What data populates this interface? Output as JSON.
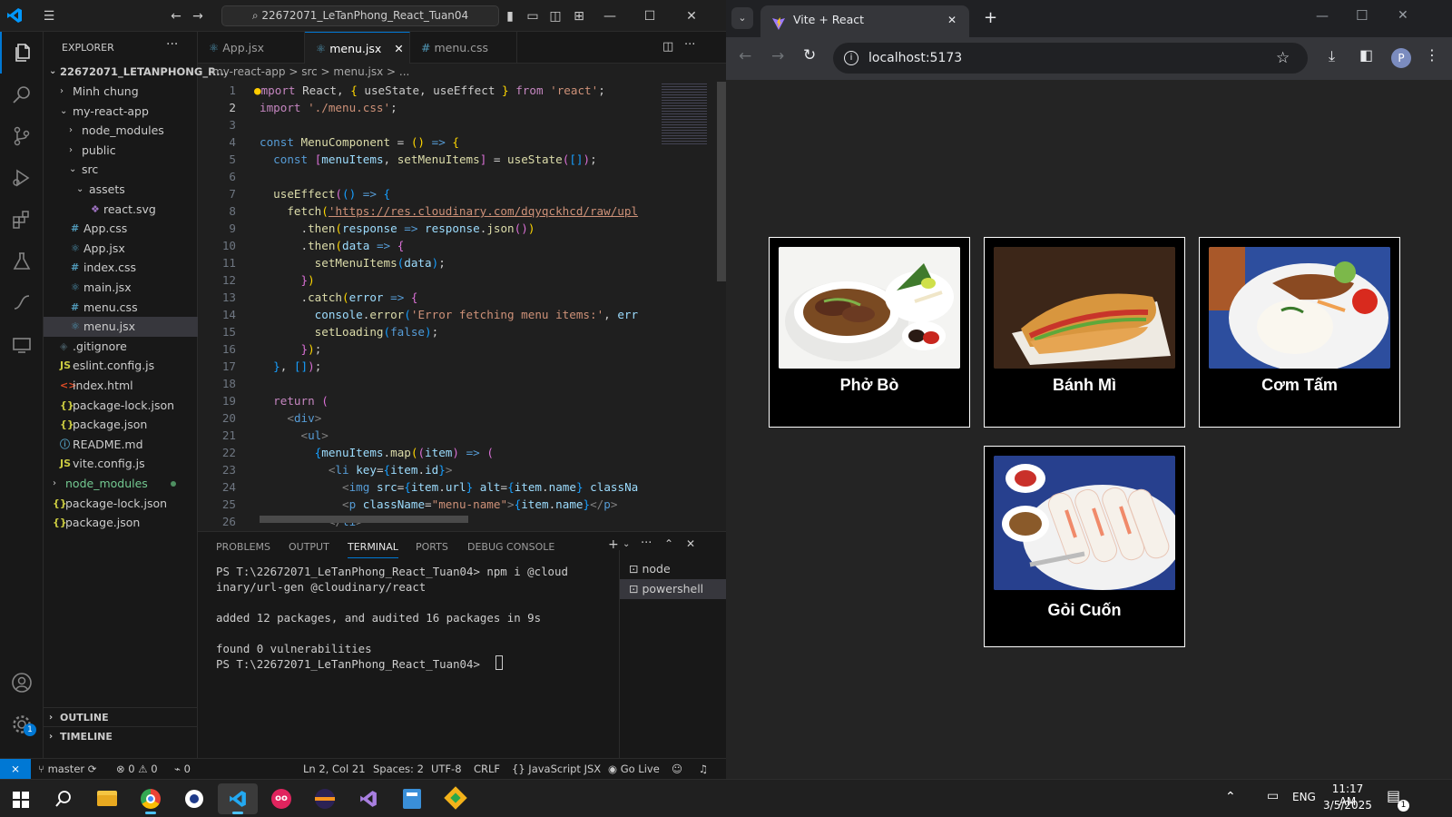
{
  "vscode": {
    "command_center": "22672071_LeTanPhong_React_Tuan04",
    "explorer": {
      "title": "EXPLORER",
      "root": "22672071_LETANPHONG_R...",
      "items": [
        {
          "label": "Minh chung",
          "kind": "folder"
        },
        {
          "label": "my-react-app",
          "kind": "folder-open"
        },
        {
          "label": "node_modules",
          "kind": "folder"
        },
        {
          "label": "public",
          "kind": "folder"
        },
        {
          "label": "src",
          "kind": "folder-open"
        },
        {
          "label": "assets",
          "kind": "folder-open"
        },
        {
          "label": "react.svg",
          "kind": "svg"
        },
        {
          "label": "App.css",
          "kind": "css"
        },
        {
          "label": "App.jsx",
          "kind": "jsx"
        },
        {
          "label": "index.css",
          "kind": "css"
        },
        {
          "label": "main.jsx",
          "kind": "jsx"
        },
        {
          "label": "menu.css",
          "kind": "css"
        },
        {
          "label": "menu.jsx",
          "kind": "jsx"
        },
        {
          "label": ".gitignore",
          "kind": "git"
        },
        {
          "label": "eslint.config.js",
          "kind": "js"
        },
        {
          "label": "index.html",
          "kind": "html"
        },
        {
          "label": "package-lock.json",
          "kind": "json"
        },
        {
          "label": "package.json",
          "kind": "json"
        },
        {
          "label": "README.md",
          "kind": "info"
        },
        {
          "label": "vite.config.js",
          "kind": "js"
        },
        {
          "label": "node_modules",
          "kind": "folder-green"
        },
        {
          "label": "package-lock.json",
          "kind": "json"
        },
        {
          "label": "package.json",
          "kind": "json"
        }
      ],
      "outline": "OUTLINE",
      "timeline": "TIMELINE"
    },
    "tabs": [
      {
        "label": "App.jsx",
        "active": false
      },
      {
        "label": "menu.jsx",
        "active": true
      },
      {
        "label": "menu.css",
        "active": false
      }
    ],
    "breadcrumb": "my-react-app > src > menu.jsx > ...",
    "code_lines": [
      "1",
      "2",
      "3",
      "4",
      "5",
      "6",
      "7",
      "8",
      "9",
      "10",
      "11",
      "12",
      "13",
      "14",
      "15",
      "16",
      "17",
      "18",
      "19",
      "20",
      "21",
      "22",
      "23",
      "24",
      "25",
      "26"
    ],
    "panel_tabs": [
      "PROBLEMS",
      "OUTPUT",
      "TERMINAL",
      "PORTS",
      "DEBUG CONSOLE"
    ],
    "terminal": "PS T:\\22672071_LeTanPhong_React_Tuan04> npm i @cloud\ninary/url-gen @cloudinary/react\n\nadded 12 packages, and audited 16 packages in 9s\n\nfound 0 vulnerabilities\nPS T:\\22672071_LeTanPhong_React_Tuan04> ",
    "terminals": [
      "node",
      "powershell"
    ],
    "status": {
      "branch": "master",
      "problems": "⊗ 0 ⚠ 0",
      "ports": "0",
      "position": "Ln 2, Col 21",
      "spaces": "Spaces: 2",
      "encoding": "UTF-8",
      "eol": "CRLF",
      "language": "JavaScript JSX",
      "golive": "Go Live"
    }
  },
  "browser": {
    "tab_title": "Vite + React",
    "url": "localhost:5173",
    "profile": "P",
    "menu": [
      {
        "name": "Phở Bò"
      },
      {
        "name": "Bánh Mì"
      },
      {
        "name": "Cơm Tấm"
      },
      {
        "name": "Gỏi Cuốn"
      }
    ]
  },
  "taskbar": {
    "lang": "ENG",
    "time": "11:17 AM",
    "date": "3/5/2025",
    "notif_count": "1"
  }
}
